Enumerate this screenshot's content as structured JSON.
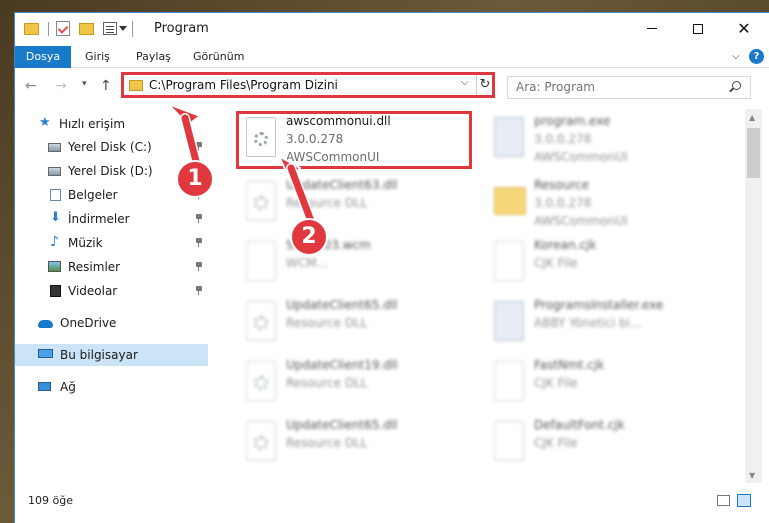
{
  "window": {
    "title": "Program"
  },
  "ribbon": {
    "tabs": [
      "Dosya",
      "Giriş",
      "Paylaş",
      "Görünüm"
    ]
  },
  "nav": {
    "address": "C:\\Program Files\\Program Dizini",
    "search_placeholder": "Ara: Program"
  },
  "sidebar": {
    "items": [
      {
        "label": "Hızlı erişim",
        "icon": "star-icon"
      },
      {
        "label": "Yerel Disk (C:)",
        "icon": "disk-icon"
      },
      {
        "label": "Yerel Disk (D:)",
        "icon": "disk-icon"
      },
      {
        "label": "Belgeler",
        "icon": "documents-icon"
      },
      {
        "label": "İndirmeler",
        "icon": "downloads-icon"
      },
      {
        "label": "Müzik",
        "icon": "music-icon"
      },
      {
        "label": "Resimler",
        "icon": "pictures-icon"
      },
      {
        "label": "Videolar",
        "icon": "videos-icon"
      },
      {
        "label": "OneDrive",
        "icon": "cloud-icon"
      },
      {
        "label": "Bu bilgisayar",
        "icon": "pc-icon"
      },
      {
        "label": "Ağ",
        "icon": "network-icon"
      }
    ]
  },
  "files": {
    "highlighted": {
      "name": "awscommonui.dll",
      "version": "3.0.0.278",
      "description": "AWSCommonUI"
    },
    "others": [
      {
        "name": "program.exe",
        "line2": "3.0.0.278",
        "line3": "AWSCommonUI"
      },
      {
        "name": "UpdateClient63.dll",
        "line2": "Resource DLL"
      },
      {
        "name": "Resource",
        "line2": "3.0.0.278",
        "line3": "AWSCommonUI"
      },
      {
        "name": "Snip...03.wcm",
        "line2": "WCM..."
      },
      {
        "name": "Korean.cjk",
        "line2": "CJK File"
      },
      {
        "name": "UpdateClient65.dll",
        "line2": "Resource DLL"
      },
      {
        "name": "ProgramsInstaller.exe",
        "line2": "ABBY Yönetici bi..."
      },
      {
        "name": "UpdateClient19.dll",
        "line2": "Resource DLL"
      },
      {
        "name": "FastNmt.cjk",
        "line2": "CJK File"
      },
      {
        "name": "UpdateClient65.dll",
        "line2": "Resource DLL"
      },
      {
        "name": "DefaultFont.cjk",
        "line2": "CJK File"
      }
    ]
  },
  "annotations": {
    "badge_1": "1",
    "badge_2": "2",
    "accent_color": "#e0383e"
  },
  "status": {
    "count": "109 öğe"
  }
}
